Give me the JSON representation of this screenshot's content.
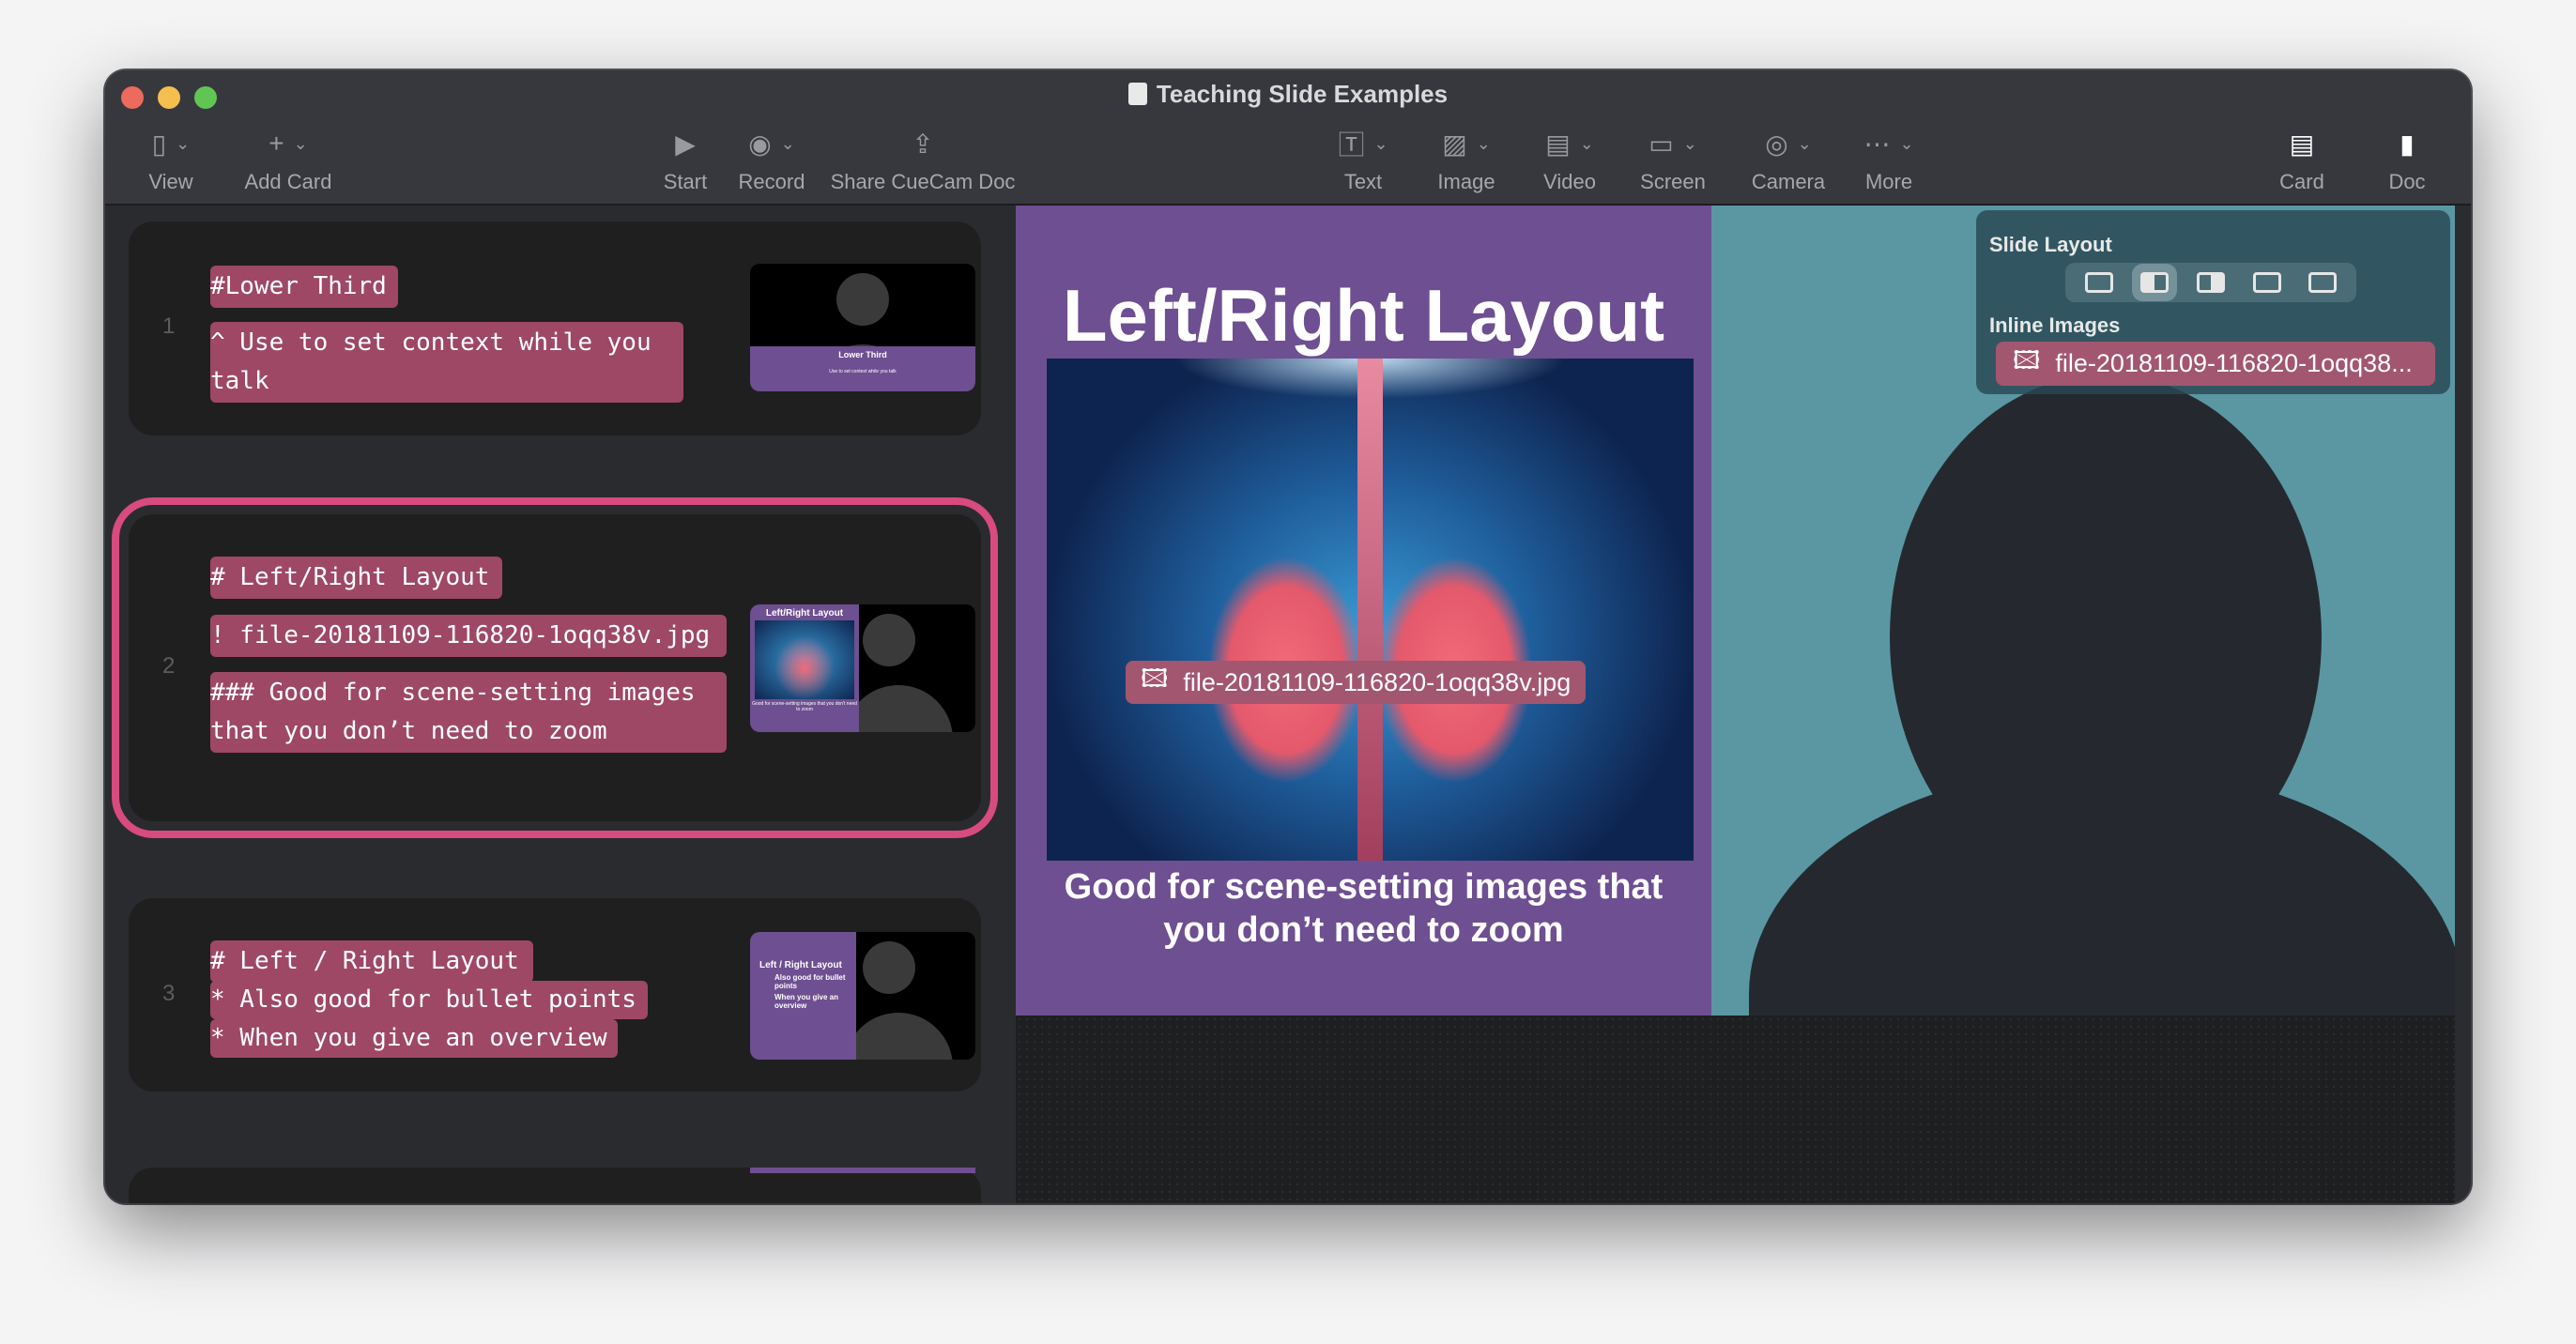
{
  "window": {
    "title": "Teaching Slide Examples"
  },
  "toolbar": {
    "left": [
      {
        "label": "View",
        "icon": "sidebar-icon"
      },
      {
        "label": "Add Card",
        "icon": "plus-icon"
      }
    ],
    "center": [
      {
        "label": "Start",
        "icon": "play-icon"
      },
      {
        "label": "Record",
        "icon": "record-icon"
      },
      {
        "label": "Share CueCam Doc",
        "icon": "share-icon"
      }
    ],
    "media": [
      {
        "label": "Text",
        "icon": "text-icon"
      },
      {
        "label": "Image",
        "icon": "image-icon"
      },
      {
        "label": "Video",
        "icon": "video-icon"
      },
      {
        "label": "Screen",
        "icon": "screen-icon"
      },
      {
        "label": "Camera",
        "icon": "camera-icon"
      },
      {
        "label": "More",
        "icon": "more-icon"
      }
    ],
    "right": [
      {
        "label": "Card",
        "icon": "card-icon"
      },
      {
        "label": "Doc",
        "icon": "doc-icon"
      }
    ]
  },
  "cards": [
    {
      "number": "1",
      "lines": [
        "#Lower Third",
        "^ Use to set context while you\ntalk"
      ],
      "thumb": {
        "title": "Lower Third",
        "subtitle": "Use to set context while you talk"
      }
    },
    {
      "number": "2",
      "lines": [
        "# Left/Right Layout",
        "! file-20181109-116820-1oqq38v.jpg",
        "### Good for scene-setting images\nthat you don’t need to zoom"
      ],
      "thumb": {
        "title": "Left/Right Layout",
        "subtitle": "Good for scene-setting images that you don't need to zoom"
      }
    },
    {
      "number": "3",
      "lines": [
        "# Left / Right Layout",
        "* Also good for bullet points",
        "* When you give an overview"
      ],
      "thumb": {
        "title": "Left / Right Layout",
        "bullets": [
          "Also good for bullet points",
          "When you give an overview"
        ]
      }
    }
  ],
  "slide": {
    "title": "Left/Right Layout",
    "image_chip": "file-20181109-116820-1oqq38v.jpg",
    "caption": "Good for scene-setting images that you don’t need to zoom"
  },
  "panel": {
    "layout_label": "Slide Layout",
    "layout_options": [
      "bottom",
      "left",
      "right",
      "center",
      "top"
    ],
    "selected_layout": "left",
    "images_label": "Inline Images",
    "image_item": "file-20181109-116820-1oqq38..."
  },
  "colors": {
    "highlight": "#9e4866",
    "selection": "#d84b7f",
    "slide_bg": "#6e4f91",
    "camera_bg": "#5a97a3"
  }
}
